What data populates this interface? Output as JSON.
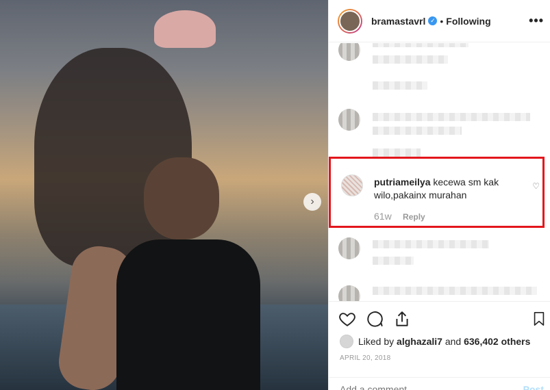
{
  "post": {
    "username": "bramastavrl",
    "verified_icon": "verified-badge-icon",
    "separator": "•",
    "follow_status": "Following",
    "more_icon": "more-options-icon"
  },
  "photo": {
    "next_icon": "chevron-right-icon"
  },
  "highlighted_comment": {
    "username": "putriameilya",
    "text": "kecewa sm kak wilo,pakainx murahan",
    "time": "61w",
    "reply_label": "Reply",
    "highlight_color": "#e3161c"
  },
  "actions": {
    "like_icon": "heart-icon",
    "comment_icon": "comment-icon",
    "share_icon": "share-icon",
    "save_icon": "bookmark-icon"
  },
  "likes": {
    "prefix": "Liked by",
    "user": "alghazali7",
    "connector": "and",
    "count_text": "636,402 others"
  },
  "date": "APRIL 20, 2018",
  "add_comment": {
    "placeholder": "Add a comment...",
    "post_label": "Post"
  },
  "colors": {
    "accent": "#3897f0",
    "post_button": "#b2dffc"
  }
}
